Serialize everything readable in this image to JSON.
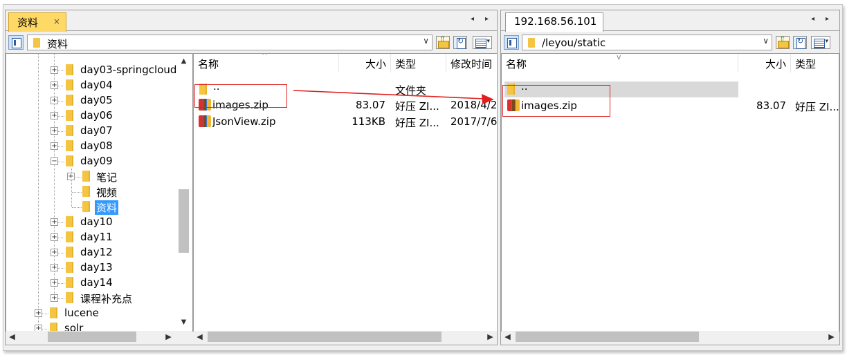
{
  "left_panel": {
    "tab_label": "资料",
    "tab_close": "×",
    "tab_nav_prev": "◂",
    "tab_nav_next": "▸",
    "path": "资料",
    "tree": [
      {
        "label": "day03-springcloud",
        "expander": "+"
      },
      {
        "label": "day04",
        "expander": "+"
      },
      {
        "label": "day05",
        "expander": "+"
      },
      {
        "label": "day06",
        "expander": "+"
      },
      {
        "label": "day07",
        "expander": "+"
      },
      {
        "label": "day08",
        "expander": "+"
      },
      {
        "label": "day09",
        "expander": "−"
      },
      {
        "label": "笔记",
        "expander": "+"
      },
      {
        "label": "视频",
        "expander": ""
      },
      {
        "label": "资料",
        "expander": "",
        "selected": true
      },
      {
        "label": "day10",
        "expander": "+"
      },
      {
        "label": "day11",
        "expander": "+"
      },
      {
        "label": "day12",
        "expander": "+"
      },
      {
        "label": "day13",
        "expander": "+"
      },
      {
        "label": "day14",
        "expander": "+"
      },
      {
        "label": "课程补充点",
        "expander": "+"
      },
      {
        "label": "lucene",
        "expander": "+"
      },
      {
        "label": "solr",
        "expander": "+"
      }
    ],
    "list": {
      "columns": [
        "名称",
        "大小",
        "类型",
        "修改时间"
      ],
      "rows": [
        {
          "name": "..",
          "size": "",
          "type": "文件夹",
          "modified": "",
          "icon": "folder-icon"
        },
        {
          "name": "images.zip",
          "size": "83.07",
          "type": "好压 ZI...",
          "modified": "2018/4/2",
          "icon": "zip-archive-icon"
        },
        {
          "name": "JsonView.zip",
          "size": "113KB",
          "type": "好压 ZI...",
          "modified": "2017/7/6,",
          "icon": "zip-archive-icon"
        }
      ]
    }
  },
  "right_panel": {
    "tab_label": "192.168.56.101",
    "tab_nav_prev": "◂",
    "tab_nav_next": "▸",
    "path": "/leyou/static",
    "list": {
      "columns": [
        "名称",
        "大小",
        "类型"
      ],
      "rows": [
        {
          "name": "..",
          "size": "",
          "type": "",
          "icon": "folder-icon"
        },
        {
          "name": "images.zip",
          "size": "83.07",
          "type": "好压 ZI...",
          "icon": "zip-archive-icon"
        }
      ]
    }
  },
  "glyphs": {
    "up": "▲",
    "down": "▼",
    "left": "◀",
    "right": "▶",
    "combo_dropdown": "∨",
    "sort_up": "^",
    "sort_down": "v"
  },
  "colors": {
    "active_tab": "#ffd966",
    "selection": "#3399ff",
    "annotation": "#e02020",
    "folder": "#f4c542"
  }
}
